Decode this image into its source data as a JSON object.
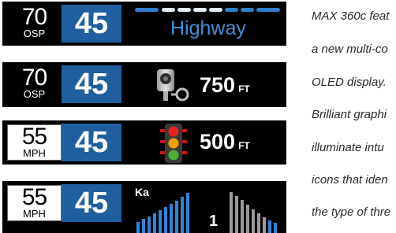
{
  "panels": [
    {
      "limit": "70",
      "unit": "OSP",
      "speed": "45",
      "label": "Highway"
    },
    {
      "limit": "70",
      "unit": "OSP",
      "speed": "45",
      "distance": "750",
      "distance_unit": "FT"
    },
    {
      "limit": "55",
      "unit": "MPH",
      "speed": "45",
      "distance": "500",
      "distance_unit": "FT"
    },
    {
      "limit": "55",
      "unit": "MPH",
      "speed": "45",
      "band": "Ka",
      "count": "1"
    }
  ],
  "caption_lines": [
    "MAX 360c feat",
    "a new multi-co",
    "OLED display.",
    "Brilliant graphi",
    "illuminate intu",
    "icons that iden",
    "the type of thre"
  ],
  "colors": {
    "speed_bg": "#1f5fa0",
    "highway": "#3e8fd6",
    "signal_red": "#e52420",
    "signal_amber": "#f5a000",
    "signal_green": "#4caf30",
    "meter_blue": "#2f86d8",
    "meter_gray": "#9a9a9a"
  },
  "icons": [
    "highway-lane-icon",
    "speed-camera-icon",
    "traffic-light-icon",
    "signal-strength-icon"
  ]
}
